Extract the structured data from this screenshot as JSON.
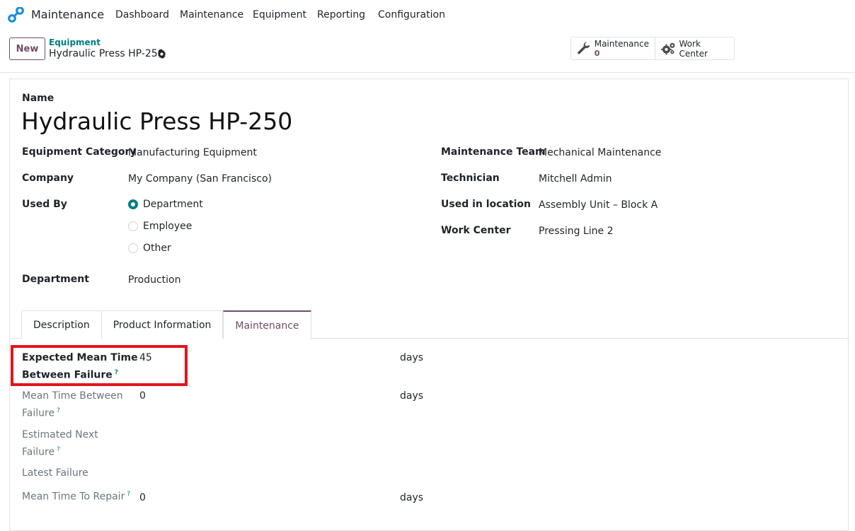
{
  "nav": {
    "app_name": "Maintenance",
    "items": [
      "Dashboard",
      "Maintenance",
      "Equipment",
      "Reporting",
      "Configuration"
    ]
  },
  "control": {
    "new_label": "New",
    "breadcrumb": "Equipment",
    "record_title": "Hydraulic Press HP-250",
    "smart_buttons": {
      "maintenance_label": "Maintenance",
      "maintenance_count": "0",
      "work_center_label": "Work Center"
    }
  },
  "form": {
    "name_label": "Name",
    "name_value": "Hydraulic Press HP-250",
    "left": {
      "category_label": "Equipment Category",
      "category_value": "Manufacturing Equipment",
      "company_label": "Company",
      "company_value": "My Company (San Francisco)",
      "used_by_label": "Used By",
      "used_by_options": [
        "Department",
        "Employee",
        "Other"
      ],
      "used_by_selected": "Department",
      "department_label": "Department",
      "department_value": "Production"
    },
    "right": {
      "team_label": "Maintenance Team",
      "team_value": "Mechanical Maintenance",
      "technician_label": "Technician",
      "technician_value": "Mitchell Admin",
      "location_label": "Used in location",
      "location_value": "Assembly Unit – Block A",
      "work_center_label": "Work Center",
      "work_center_value": "Pressing Line 2"
    },
    "tabs": [
      "Description",
      "Product Information",
      "Maintenance"
    ],
    "active_tab": "Maintenance",
    "maintenance": {
      "emtbf_label_1": "Expected Mean Time",
      "emtbf_label_2": "Between Failure",
      "emtbf_value": "45",
      "emtbf_unit": "days",
      "mtbf_label_1": "Mean Time Between",
      "mtbf_label_2": "Failure",
      "mtbf_value": "0",
      "mtbf_unit": "days",
      "next_label_1": "Estimated Next",
      "next_label_2": "Failure",
      "latest_label": "Latest Failure",
      "mttr_label": "Mean Time To Repair",
      "mttr_value": "0",
      "mttr_unit": "days",
      "tooltip_mark": "?"
    }
  },
  "colors": {
    "brand": "#714b67",
    "accent": "#017e84",
    "highlight": "#e3151a"
  }
}
